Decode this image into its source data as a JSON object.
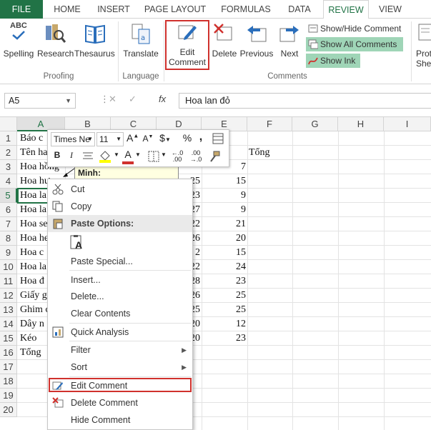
{
  "tabs": [
    "FILE",
    "HOME",
    "INSERT",
    "PAGE LAYOUT",
    "FORMULAS",
    "DATA",
    "REVIEW",
    "VIEW"
  ],
  "ribbon": {
    "spelling": "Spelling",
    "research": "Research",
    "thesaurus": "Thesaurus",
    "translate": "Translate",
    "edit_comment": "Edit Comment",
    "delete": "Delete",
    "previous": "Previous",
    "next": "Next",
    "show_hide_comment": "Show/Hide Comment",
    "show_all_comments": "Show All Comments",
    "show_ink": "Show Ink",
    "protect": "Prot",
    "share": "She",
    "groups": {
      "proofing": "Proofing",
      "language": "Language",
      "comments": "Comments"
    },
    "abc": "ABC"
  },
  "formula_bar": {
    "name_box": "A5",
    "fx": "fx",
    "formula": "Hoa lan đỏ"
  },
  "columns": [
    "A",
    "B",
    "C",
    "D",
    "E",
    "F",
    "G",
    "H",
    "I"
  ],
  "rows": [
    "1",
    "2",
    "3",
    "4",
    "5",
    "6",
    "7",
    "8",
    "9",
    "10",
    "11",
    "12",
    "13",
    "14",
    "15",
    "16",
    "17",
    "18",
    "19",
    "20"
  ],
  "cells": {
    "a1": "Báo c",
    "a2": "Tên ha",
    "a3": "Hoa hồng",
    "a4": "Hoa hư",
    "a5": "Hoa la",
    "a6": "Hoa la",
    "a7": "Hoa se",
    "a8": "Hoa he",
    "a9": "Hoa c",
    "a10": "Hoa la",
    "a11": "Hoa đ",
    "a12": "Giấy g",
    "a13": "Ghim c",
    "a14": "Dây n",
    "a15": "Kéo",
    "a16": "Tổng",
    "f2": "Tổng",
    "d": [
      "25",
      "23",
      "27",
      "22",
      "26",
      "2",
      "22",
      "28",
      "26",
      "25",
      "20",
      "20"
    ],
    "e": [
      "7",
      "15",
      "9",
      "9",
      "21",
      "20",
      "15",
      "24",
      "23",
      "25",
      "25",
      "12",
      "23"
    ]
  },
  "comment": "Minh:",
  "mini_toolbar": {
    "font": "Times Ne",
    "size": "11",
    "grow": "A",
    "shrink": "A",
    "currency": "$",
    "percent": "%",
    "comma": ",",
    "bold": "B",
    "italic": "I",
    "font_color": "A",
    "dec_inc": "←.0 .00",
    "dec_dec": ".00 →.0"
  },
  "context_menu": {
    "cut": "Cut",
    "copy": "Copy",
    "paste_options": "Paste Options:",
    "paste_special": "Paste Special...",
    "insert": "Insert...",
    "delete": "Delete...",
    "clear_contents": "Clear Contents",
    "quick_analysis": "Quick Analysis",
    "filter": "Filter",
    "sort": "Sort",
    "edit_comment": "Edit Comment",
    "delete_comment": "Delete Comment",
    "hide_comment": "Hide Comment",
    "paste_a": "A"
  },
  "colors": {
    "accent": "#217346",
    "highlight": "#d0312d",
    "toggle_on": "#9fd5b7",
    "comment_bg": "#ffffe1"
  }
}
